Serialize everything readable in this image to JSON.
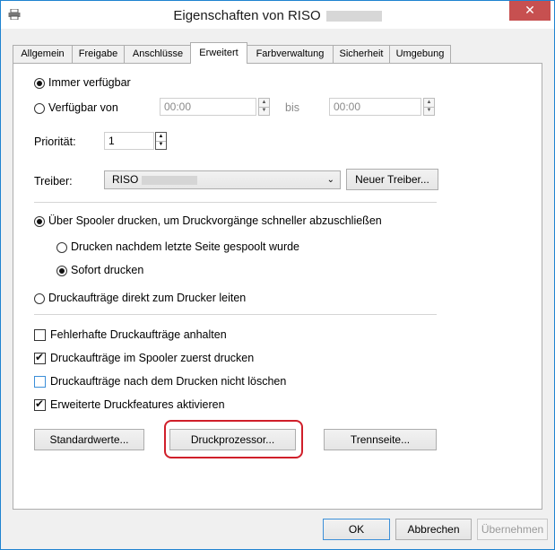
{
  "window": {
    "title": "Eigenschaften von RISO",
    "close_symbol": "✕"
  },
  "tabs": [
    "Allgemein",
    "Freigabe",
    "Anschlüsse",
    "Erweitert",
    "Farbverwaltung",
    "Sicherheit",
    "Umgebung"
  ],
  "active_tab": "Erweitert",
  "availability": {
    "always_label": "Immer verfügbar",
    "from_label": "Verfügbar von",
    "from_time": "00:00",
    "to_label": "bis",
    "to_time": "00:00",
    "selected": "always"
  },
  "priority": {
    "label": "Priorität:",
    "value": "1"
  },
  "driver": {
    "label": "Treiber:",
    "value": "RISO",
    "new_button": "Neuer Treiber..."
  },
  "spool": {
    "spooler_label": "Über Spooler drucken, um Druckvorgänge schneller abzuschließen",
    "after_last_page_label": "Drucken nachdem letzte Seite gespoolt wurde",
    "immediately_label": "Sofort drucken",
    "direct_label": "Druckaufträge direkt zum Drucker leiten"
  },
  "checkboxes": {
    "hold_mismatched": {
      "label": "Fehlerhafte Druckaufträge anhalten",
      "checked": false
    },
    "spooled_first": {
      "label": "Druckaufträge im Spooler zuerst drucken",
      "checked": true
    },
    "keep_printed": {
      "label": "Druckaufträge nach dem Drucken nicht löschen",
      "checked": false
    },
    "advanced_features": {
      "label": "Erweiterte Druckfeatures aktivieren",
      "checked": true
    }
  },
  "panel_buttons": {
    "defaults": "Standardwerte...",
    "processor": "Druckprozessor...",
    "separator": "Trennseite..."
  },
  "footer": {
    "ok": "OK",
    "cancel": "Abbrechen",
    "apply": "Übernehmen"
  },
  "colors": {
    "highlight": "#d01f2a",
    "close_button": "#c75050",
    "accent": "#1f83d0"
  }
}
